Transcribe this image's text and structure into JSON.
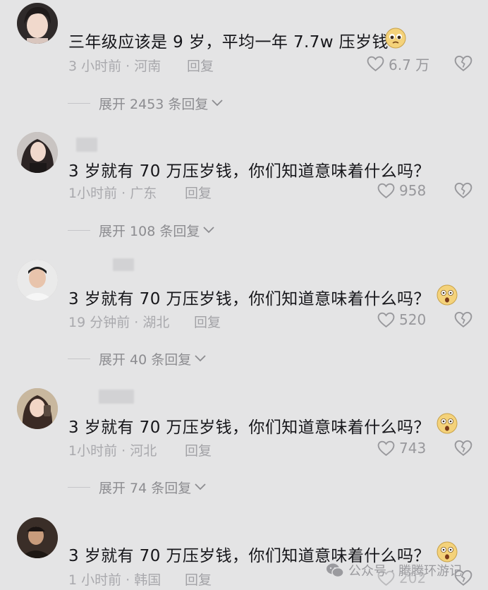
{
  "comments": [
    {
      "text": "三年级应该是 9 岁，平均一年 7.7w 压岁钱",
      "time": "3 小时前",
      "location": "河南",
      "reply": "回复",
      "likes": "6.7 万",
      "expand": "展开 2453 条回复",
      "emoji": "pleading-face"
    },
    {
      "text": "3 岁就有 70 万压岁钱，你们知道意味着什么吗？",
      "time": "1小时前",
      "location": "广东",
      "reply": "回复",
      "likes": "958",
      "expand": "展开 108 条回复",
      "emoji": ""
    },
    {
      "text": "3 岁就有 70 万压岁钱，你们知道意味着什么吗？",
      "time": "19 分钟前",
      "location": "湖北",
      "reply": "回复",
      "likes": "520",
      "expand": "展开 40 条回复",
      "emoji": "astonished-face"
    },
    {
      "text": "3 岁就有 70 万压岁钱，你们知道意味着什么吗？",
      "time": "1小时前",
      "location": "河北",
      "reply": "回复",
      "likes": "743",
      "expand": "展开 74 条回复",
      "emoji": "astonished-face"
    },
    {
      "text": "3 岁就有 70 万压岁钱，你们知道意味着什么吗？",
      "time": "1 小时前",
      "location": "韩国",
      "reply": "回复",
      "likes": "202",
      "expand": "",
      "emoji": "astonished-face"
    }
  ],
  "watermark": {
    "text": "公众号 · 腾腾环游记",
    "icon": "wechat-icon"
  },
  "colors": {
    "background": "#e4e4e5",
    "text": "#16161a",
    "meta": "#a9a9ad"
  }
}
